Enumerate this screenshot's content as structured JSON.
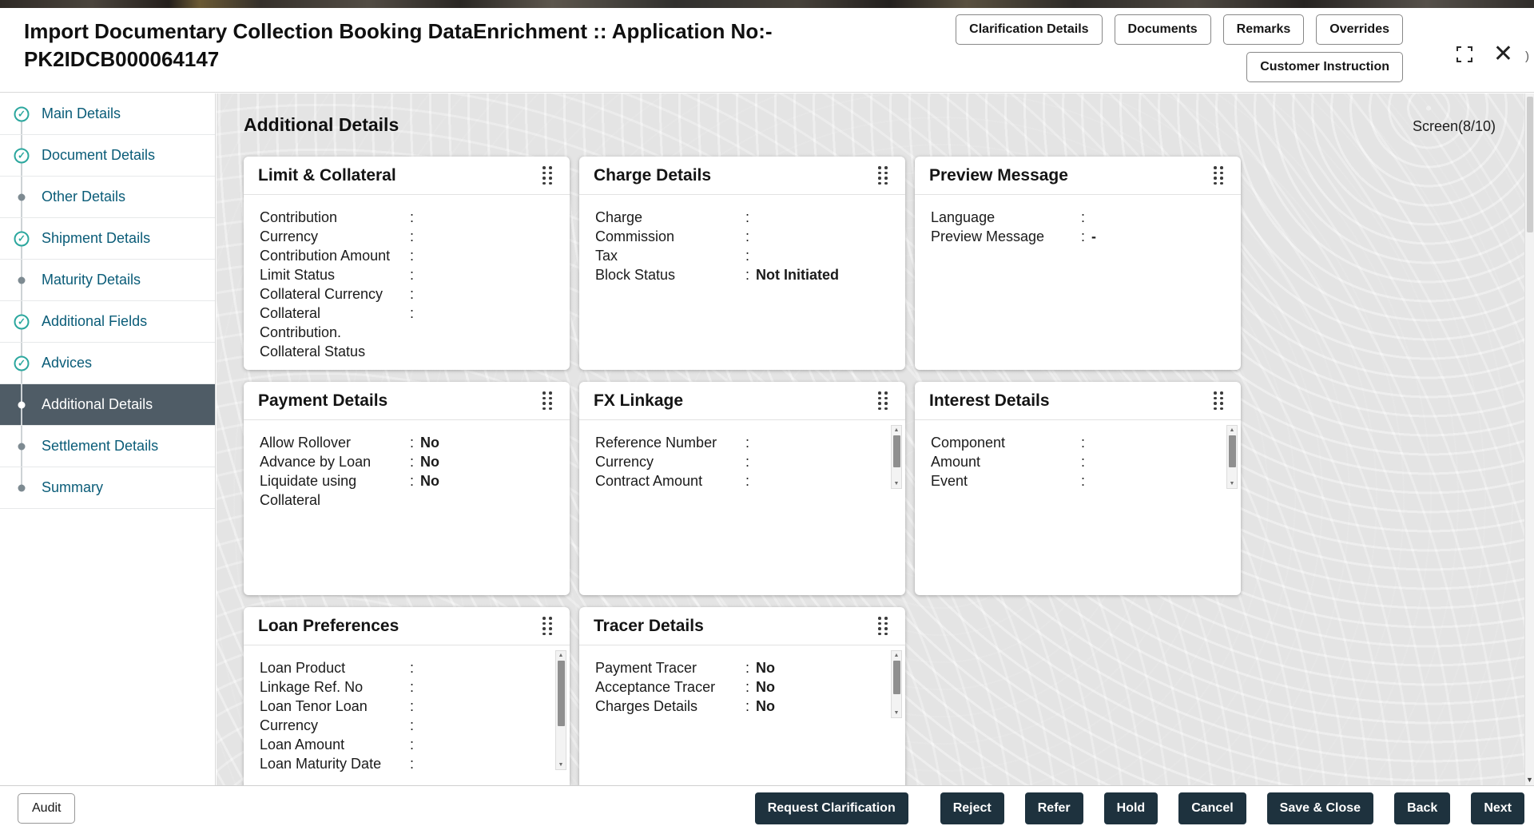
{
  "colors": {
    "accent_teal": "#2ba79e",
    "step_active_bg": "#4f5c66",
    "sidebar_link": "#0a5c78",
    "dark_button": "#1e323e",
    "content_bg": "#ebebeb"
  },
  "header": {
    "title_line1": "Import Documentary Collection Booking DataEnrichment :: Application No:-",
    "title_line2": "PK2IDCB000064147",
    "buttons": [
      "Clarification Details",
      "Documents",
      "Remarks",
      "Overrides"
    ],
    "customer_instruction": "Customer Instruction",
    "corner_artifact": ")"
  },
  "sidebar": {
    "items": [
      {
        "label": "Main Details",
        "state": "done"
      },
      {
        "label": "Document Details",
        "state": "done"
      },
      {
        "label": "Other Details",
        "state": "pending"
      },
      {
        "label": "Shipment Details",
        "state": "done"
      },
      {
        "label": "Maturity Details",
        "state": "pending"
      },
      {
        "label": "Additional Fields",
        "state": "done"
      },
      {
        "label": "Advices",
        "state": "done"
      },
      {
        "label": "Additional Details",
        "state": "active"
      },
      {
        "label": "Settlement Details",
        "state": "pending"
      },
      {
        "label": "Summary",
        "state": "pending"
      }
    ]
  },
  "content": {
    "heading": "Additional Details",
    "screen_indicator": "Screen(8/10)",
    "cards": [
      {
        "title": "Limit & Collateral",
        "has_scrollbar": false,
        "rows": [
          {
            "label": "Contribution",
            "colon": true,
            "value": "",
            "bold": false
          },
          {
            "label": "Currency",
            "colon": true,
            "value": "",
            "bold": false
          },
          {
            "label": "Contribution Amount",
            "colon": true,
            "value": "",
            "bold": false
          },
          {
            "label": "Limit Status",
            "colon": true,
            "value": "",
            "bold": false
          },
          {
            "label": "Collateral Currency",
            "colon": true,
            "value": "",
            "bold": false
          },
          {
            "label": "Collateral",
            "colon": true,
            "value": "",
            "bold": false
          },
          {
            "label": "Contribution.",
            "colon": false,
            "value": "",
            "bold": false
          },
          {
            "label": "Collateral Status",
            "colon": false,
            "value": "",
            "bold": false
          }
        ]
      },
      {
        "title": "Charge Details",
        "has_scrollbar": false,
        "rows": [
          {
            "label": "Charge",
            "colon": true,
            "value": "",
            "bold": false
          },
          {
            "label": "Commission",
            "colon": true,
            "value": "",
            "bold": false
          },
          {
            "label": "Tax",
            "colon": true,
            "value": "",
            "bold": false
          },
          {
            "label": "Block Status",
            "colon": true,
            "value": "Not Initiated",
            "bold": true
          }
        ]
      },
      {
        "title": "Preview Message",
        "has_scrollbar": false,
        "rows": [
          {
            "label": "Language",
            "colon": true,
            "value": "",
            "bold": false
          },
          {
            "label": "Preview Message",
            "colon": true,
            "value": "-",
            "bold": true
          }
        ]
      },
      {
        "title": "Payment Details",
        "has_scrollbar": false,
        "rows": [
          {
            "label": "Allow Rollover",
            "colon": true,
            "value": "No",
            "bold": true
          },
          {
            "label": "Advance by Loan",
            "colon": true,
            "value": "No",
            "bold": true
          },
          {
            "label": "Liquidate using",
            "colon": true,
            "value": "No",
            "bold": true
          },
          {
            "label": "Collateral",
            "colon": false,
            "value": "",
            "bold": false
          }
        ]
      },
      {
        "title": "FX Linkage",
        "has_scrollbar": true,
        "rows": [
          {
            "label": "Reference Number",
            "colon": true,
            "value": "",
            "bold": false
          },
          {
            "label": "Currency",
            "colon": true,
            "value": "",
            "bold": false
          },
          {
            "label": "Contract Amount",
            "colon": true,
            "value": "",
            "bold": false
          }
        ]
      },
      {
        "title": "Interest Details",
        "has_scrollbar": true,
        "rows": [
          {
            "label": "Component",
            "colon": true,
            "value": "",
            "bold": false
          },
          {
            "label": "Amount",
            "colon": true,
            "value": "",
            "bold": false
          },
          {
            "label": "Event",
            "colon": true,
            "value": "",
            "bold": false
          }
        ]
      },
      {
        "title": "Loan Preferences",
        "has_scrollbar": true,
        "rows": [
          {
            "label": "Loan Product",
            "colon": true,
            "value": "",
            "bold": false
          },
          {
            "label": "Linkage Ref. No",
            "colon": true,
            "value": "",
            "bold": false
          },
          {
            "label": "Loan Tenor Loan",
            "colon": true,
            "value": "",
            "bold": false
          },
          {
            "label": "Currency",
            "colon": true,
            "value": "",
            "bold": false
          },
          {
            "label": "Loan Amount",
            "colon": true,
            "value": "",
            "bold": false
          },
          {
            "label": "Loan Maturity Date",
            "colon": true,
            "value": "",
            "bold": false
          }
        ]
      },
      {
        "title": "Tracer Details",
        "has_scrollbar": true,
        "rows": [
          {
            "label": "Payment Tracer",
            "colon": true,
            "value": "No",
            "bold": true
          },
          {
            "label": "Acceptance Tracer",
            "colon": true,
            "value": "No",
            "bold": true
          },
          {
            "label": "Charges Details",
            "colon": true,
            "value": "No",
            "bold": true
          }
        ]
      }
    ]
  },
  "footer": {
    "audit_label": "Audit",
    "actions": [
      "Request Clarification",
      "Reject",
      "Refer",
      "Hold",
      "Cancel",
      "Save & Close",
      "Back",
      "Next"
    ]
  }
}
